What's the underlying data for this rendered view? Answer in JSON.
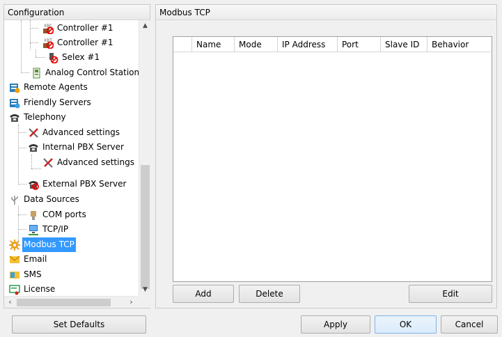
{
  "left_panel": {
    "title": "Configuration",
    "tree": [
      {
        "label": "Controller #1",
        "icon": "xbc-controller-icon"
      },
      {
        "label": "Controller #1",
        "icon": "xbt-controller-icon"
      },
      {
        "label": "Selex #1",
        "icon": "selex-icon"
      },
      {
        "label": "Analog Control Station:",
        "icon": "analog-station-icon"
      },
      {
        "label": "Remote Agents",
        "icon": "remote-agents-icon"
      },
      {
        "label": "Friendly Servers",
        "icon": "friendly-servers-icon"
      },
      {
        "label": "Telephony",
        "icon": "telephone-icon"
      },
      {
        "label": "Advanced settings",
        "icon": "tools-icon"
      },
      {
        "label": "Internal PBX Server",
        "icon": "telephone-icon"
      },
      {
        "label": "Advanced settings",
        "icon": "tools-icon"
      },
      {
        "label": "External PBX Server",
        "icon": "external-pbx-icon"
      },
      {
        "label": "Data Sources",
        "icon": "usb-icon"
      },
      {
        "label": "COM ports",
        "icon": "com-port-icon"
      },
      {
        "label": "TCP/IP",
        "icon": "network-icon"
      },
      {
        "label": "Modbus TCP",
        "icon": "modbus-gear-icon",
        "selected": true
      },
      {
        "label": "Email",
        "icon": "email-icon"
      },
      {
        "label": "SMS",
        "icon": "sms-icon"
      },
      {
        "label": "License",
        "icon": "license-icon"
      }
    ]
  },
  "right_panel": {
    "title": "Modbus TCP",
    "columns": [
      "Name",
      "Mode",
      "IP Address",
      "Port",
      "Slave ID",
      "Behavior"
    ],
    "rows": [],
    "buttons": {
      "add": "Add",
      "delete": "Delete",
      "edit": "Edit"
    }
  },
  "footer": {
    "set_defaults": "Set Defaults",
    "apply": "Apply",
    "ok": "OK",
    "cancel": "Cancel"
  },
  "colors": {
    "selection": "#3399ff",
    "ok_border": "#7eb4ea"
  }
}
